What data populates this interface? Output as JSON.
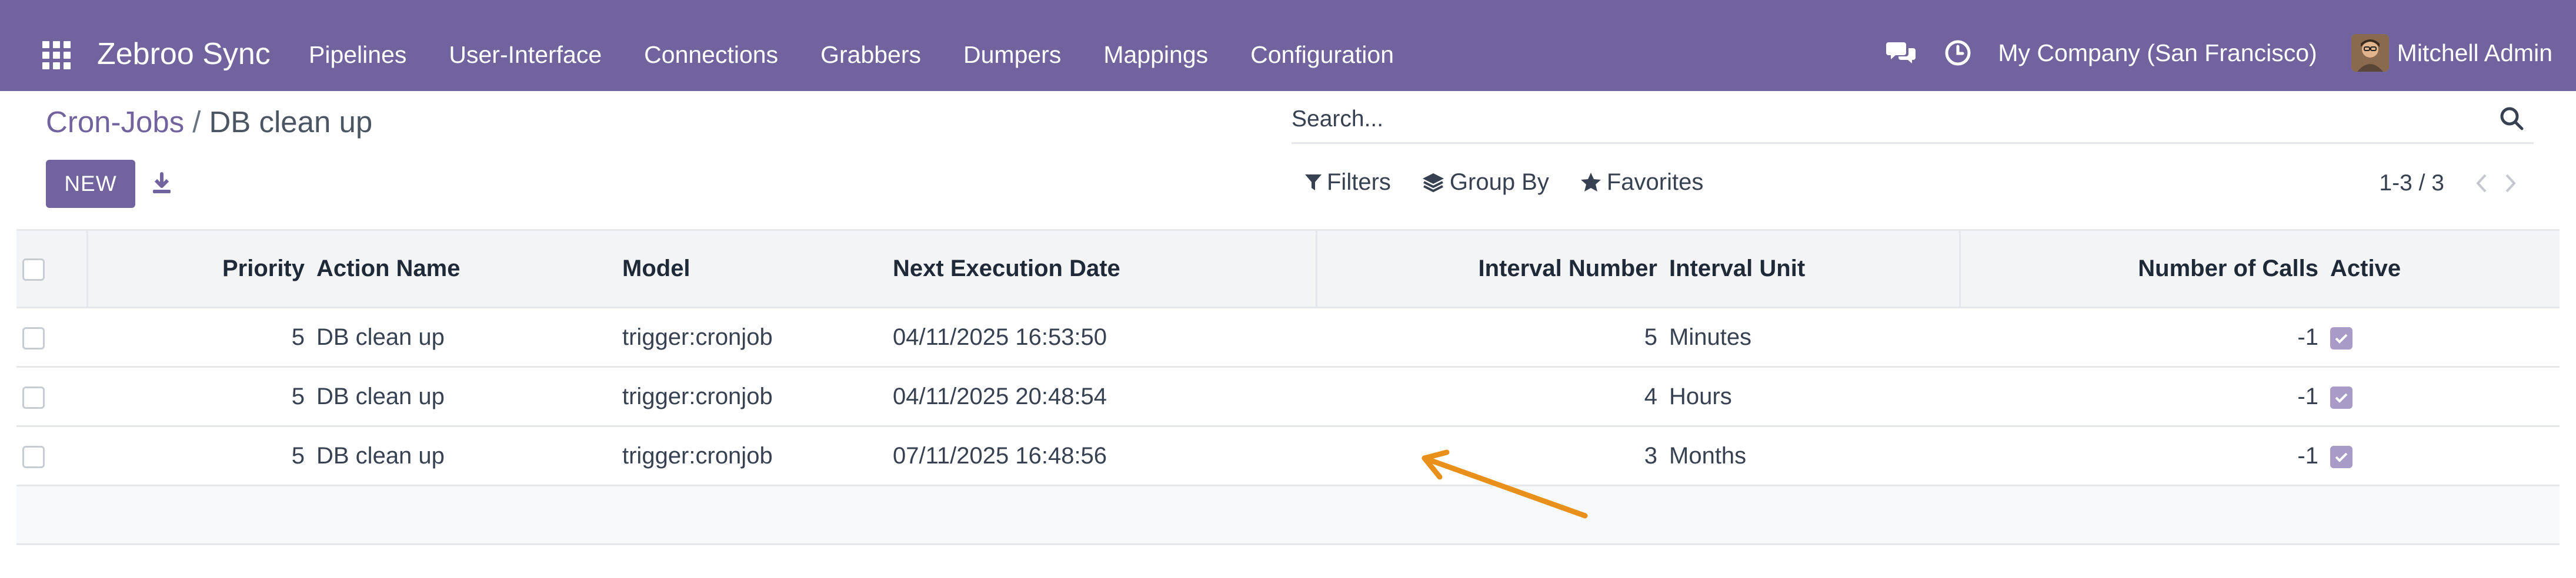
{
  "navbar": {
    "app_title": "Zebroo Sync",
    "menu": [
      "Pipelines",
      "User-Interface",
      "Connections",
      "Grabbers",
      "Dumpers",
      "Mappings",
      "Configuration"
    ],
    "company": "My Company (San Francisco)",
    "user": "Mitchell Admin",
    "icons": [
      "apps-grid-icon",
      "chat-bubbles-icon",
      "clock-icon"
    ]
  },
  "breadcrumb": {
    "parent": "Cron-Jobs",
    "separator": "/",
    "current": "DB clean up"
  },
  "toolbar": {
    "new_label": "NEW",
    "search_placeholder": "Search...",
    "filters_label": "Filters",
    "group_by_label": "Group By",
    "favorites_label": "Favorites",
    "pager": "1-3 / 3"
  },
  "table": {
    "columns": [
      "Priority",
      "Action Name",
      "Model",
      "Next Execution Date",
      "Interval Number",
      "Interval Unit",
      "Number of Calls",
      "Active"
    ],
    "rows": [
      {
        "priority": "5",
        "action": "DB clean up",
        "model": "trigger:cronjob",
        "next_date": "04/11/2025 16:53:50",
        "interval_number": "5",
        "interval_unit": "Minutes",
        "calls": "-1",
        "active": true
      },
      {
        "priority": "5",
        "action": "DB clean up",
        "model": "trigger:cronjob",
        "next_date": "04/11/2025 20:48:54",
        "interval_number": "4",
        "interval_unit": "Hours",
        "calls": "-1",
        "active": true
      },
      {
        "priority": "5",
        "action": "DB clean up",
        "model": "trigger:cronjob",
        "next_date": "07/11/2025 16:48:56",
        "interval_number": "3",
        "interval_unit": "Months",
        "calls": "-1",
        "active": true
      }
    ]
  },
  "colors": {
    "brand": "#71639e",
    "active_checkbox": "#a89bc8",
    "annotation_arrow": "#e8901a"
  }
}
